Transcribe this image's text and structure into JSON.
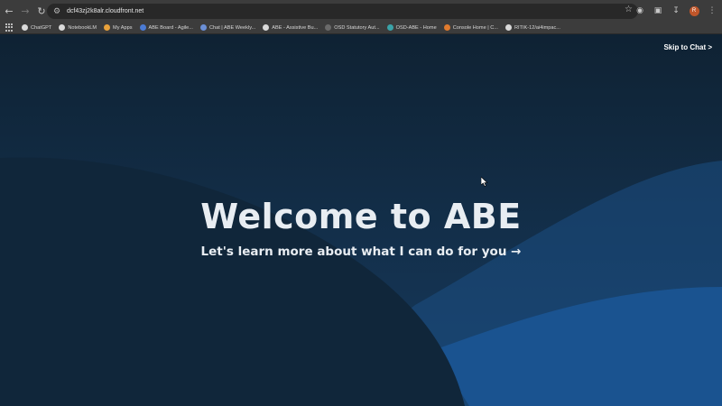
{
  "browser": {
    "url": "dcf43zj2k8alr.cloudfront.net",
    "profile_initial": "R",
    "bookmarks": [
      {
        "label": "ChatGPT",
        "icon_color": "#d9d9d9"
      },
      {
        "label": "NotebookLM",
        "icon_color": "#d9d9d9"
      },
      {
        "label": "My Apps",
        "icon_color": "#e9a23b"
      },
      {
        "label": "ABE Board - Agile...",
        "icon_color": "#4b7bd4"
      },
      {
        "label": "Chat | ABE Weekly...",
        "icon_color": "#6b8fd6"
      },
      {
        "label": "ABE - Assistive Bu...",
        "icon_color": "#d9d9d9"
      },
      {
        "label": "OSD Statutory Aut...",
        "icon_color": "#6a6a6a"
      },
      {
        "label": "OSD-ABE - Home",
        "icon_color": "#3aa3a8"
      },
      {
        "label": "Console Home | C...",
        "icon_color": "#e07b2e"
      },
      {
        "label": "RITIK-12/ai4impac...",
        "icon_color": "#d9d9d9"
      }
    ]
  },
  "page": {
    "skip_link": "Skip to Chat >",
    "title": "Welcome to ABE",
    "subtitle": "Let's learn more about what I can do for you →"
  },
  "colors": {
    "background_dark": "#0f2233",
    "accent_blue": "#1c4e84",
    "text": "#e8edf2"
  }
}
